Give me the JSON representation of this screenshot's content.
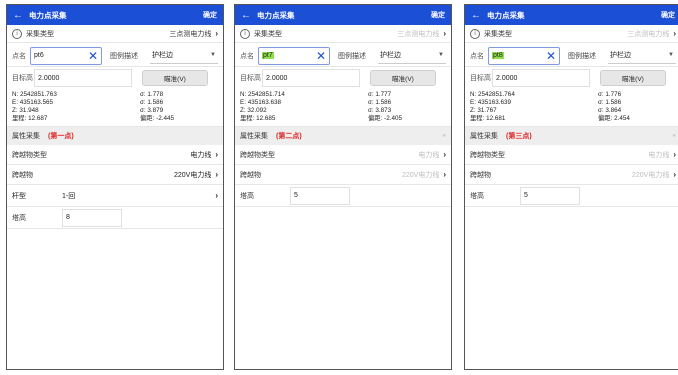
{
  "screens": [
    {
      "title": "电力点采集",
      "confirm": "确定",
      "collect_type_label": "采集类型",
      "collect_type_value": "三点测电力线",
      "point_label": "点名",
      "point_name": "pt6",
      "legend_label": "图例描述",
      "legend_value": "护栏边",
      "target_height_label": "目标高",
      "target_height": "2.0000",
      "aim_button": "瞄准(V)",
      "coords": {
        "N": "N: 2542851.763",
        "E": "E: 435163.565",
        "Z": "Z: 31.948",
        "mileage": "里程: 12.687",
        "sigma_h": "σ: 1.778",
        "sigma_e": "σ: 1.586",
        "sigma_z": "σ: 3.879",
        "offset": "偏距: -2.445"
      },
      "attr_title": "属性采集",
      "attr_index": "(第一点)",
      "cross_type_label": "跨越物类型",
      "cross_type_value": "电力线",
      "cross_label": "跨越物",
      "cross_value": "220V电力线",
      "pole_label": "杆型",
      "pole_value": "1-回",
      "tall_label": "塔高",
      "tall_value": "8"
    },
    {
      "title": "电力点采集",
      "confirm": "确定",
      "collect_type_label": "采集类型",
      "collect_type_value": "三点测电力线",
      "point_label": "点名",
      "point_name": "pt7",
      "legend_label": "图例描述",
      "legend_value": "护栏边",
      "target_height_label": "目标高",
      "target_height": "2.0000",
      "aim_button": "瞄准(V)",
      "coords": {
        "N": "N: 2542851.714",
        "E": "E: 435163.638",
        "Z": "Z: 32.092",
        "mileage": "里程: 12.685",
        "sigma_h": "σ: 1.777",
        "sigma_e": "σ: 1.586",
        "sigma_z": "σ: 3.873",
        "offset": "偏距: -2.405"
      },
      "attr_title": "属性采集",
      "attr_index": "(第二点)",
      "cross_type_label": "跨越物类型",
      "cross_type_value": "电力线",
      "cross_label": "跨越物",
      "cross_value": "220V电力线",
      "tall_label": "塔高",
      "tall_value": "5"
    },
    {
      "title": "电力点采集",
      "confirm": "确定",
      "collect_type_label": "采集类型",
      "collect_type_value": "三点测电力线",
      "point_label": "点名",
      "point_name": "pt8",
      "legend_label": "图例描述",
      "legend_value": "护栏边",
      "target_height_label": "目标高",
      "target_height": "2.0000",
      "aim_button": "瞄准(V)",
      "coords": {
        "N": "N: 2542851.764",
        "E": "E: 435163.639",
        "Z": "Z: 31.767",
        "mileage": "里程: 12.681",
        "sigma_h": "σ: 1.776",
        "sigma_e": "σ: 1.586",
        "sigma_z": "σ: 3.864",
        "offset": "偏距: 2.454"
      },
      "attr_title": "属性采集",
      "attr_index": "(第三点)",
      "cross_type_label": "跨越物类型",
      "cross_type_value": "电力线",
      "cross_label": "跨越物",
      "cross_value": "220V电力线",
      "tall_label": "塔高",
      "tall_value": "5"
    }
  ],
  "icons": {
    "back": "back-arrow-icon",
    "clear": "clear-x-icon",
    "chevron": "chevron-right-icon",
    "dropdown": "dropdown-caret-icon",
    "info": "info-circle-icon"
  },
  "colors": {
    "topbar": "#1a4fd6",
    "highlight": "#8ee04a",
    "attr_index": "#e02020"
  }
}
